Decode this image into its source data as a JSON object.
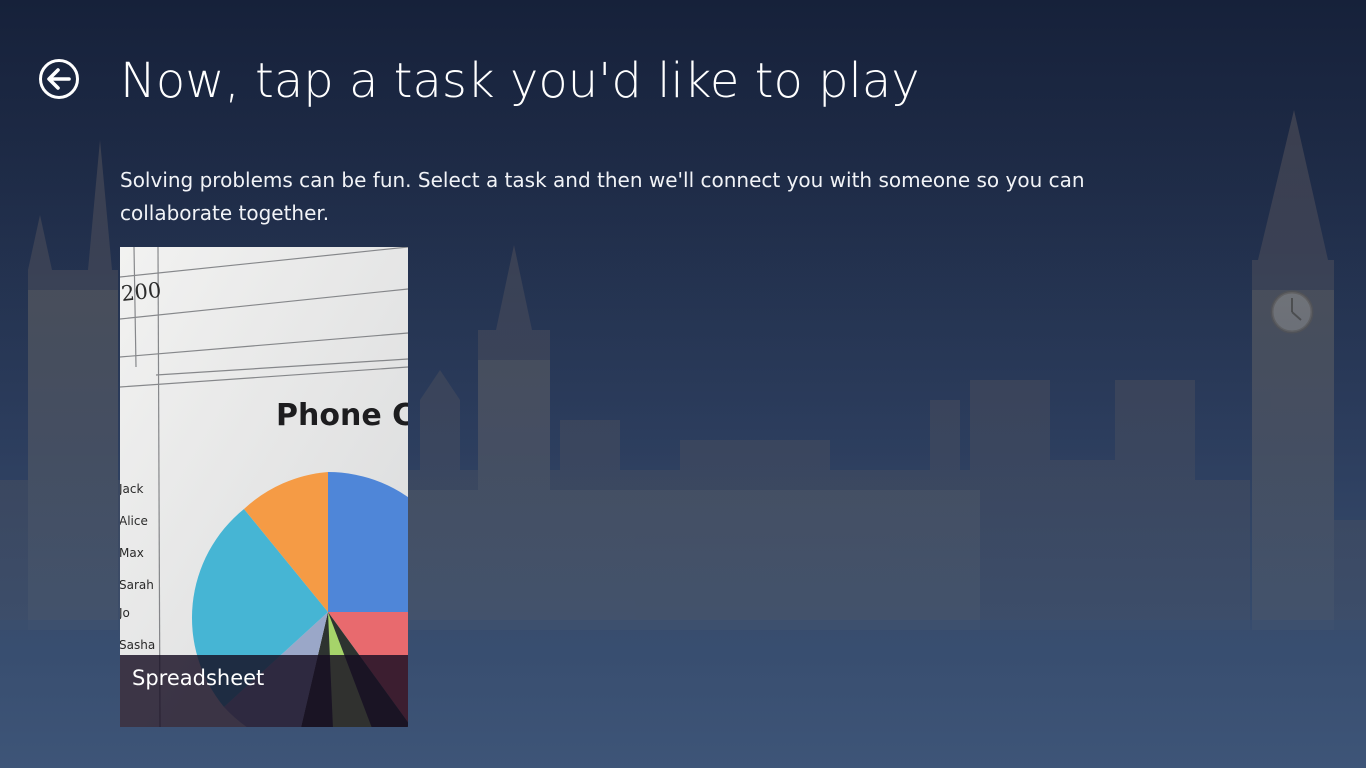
{
  "header": {
    "back_icon": "back-arrow-circle-icon",
    "title": "Now, tap a task you'd like to play"
  },
  "intro": {
    "text": "Solving problems can be fun. Select a task and then we'll connect you with someone so you can collaborate together."
  },
  "tasks": [
    {
      "label": "Spreadsheet",
      "image": {
        "cell_value": "200",
        "heading": "Phone C",
        "names": [
          "Jack",
          "Alice",
          "Max",
          "Sarah",
          "Jo",
          "Sasha"
        ]
      }
    }
  ],
  "colors": {
    "background_top": "#16213a",
    "background_bottom": "#3e5578",
    "caption_bar": "#160e22"
  }
}
